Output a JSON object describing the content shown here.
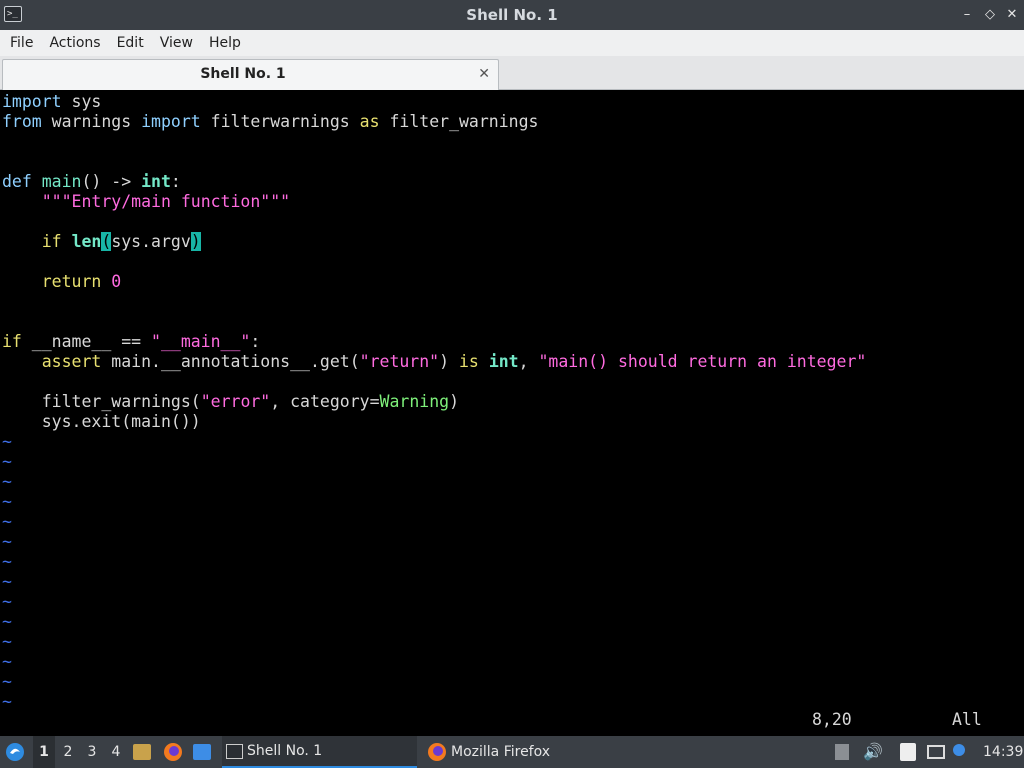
{
  "window": {
    "title": "Shell No. 1",
    "controls": {
      "minimize": "–",
      "restore": "◇",
      "close": "✕"
    }
  },
  "menu": [
    "File",
    "Actions",
    "Edit",
    "View",
    "Help"
  ],
  "tab": {
    "label": "Shell No. 1",
    "close": "✕"
  },
  "editor": {
    "lines": {
      "l1": {
        "import": "import",
        "mod": " sys"
      },
      "l2": {
        "from": "from",
        "mod": " warnings ",
        "import": "import",
        "name": " filterwarnings ",
        "as": "as",
        "alias": " filter_warnings"
      },
      "l3": {
        "def": "def",
        "sp": " ",
        "name": "main",
        "sig": "() -> ",
        "type": "int",
        "colon": ":"
      },
      "l4": {
        "indent": "    ",
        "doc": "\"\"\"Entry/main function\"\"\""
      },
      "l5": {
        "indent": "    ",
        "if": "if",
        "sp": " ",
        "len": "len",
        "open": "(",
        "arg": "sys.argv",
        "close": ")"
      },
      "l6": {
        "indent": "    ",
        "return": "return",
        "sp": " ",
        "val": "0"
      },
      "l7": {
        "if": "if",
        "cond": " __name__ == ",
        "str": "\"__main__\"",
        "colon": ":"
      },
      "l8": {
        "indent": "    ",
        "assert": "assert",
        "expr1": " main.__annotations__.get(",
        "s1": "\"return\"",
        "expr2": ") ",
        "is": "is",
        "sp": " ",
        "int": "int",
        "comma": ", ",
        "s2": "\"main() should return an integer\""
      },
      "l9": {
        "indent": "    ",
        "call": "filter_warnings(",
        "s1": "\"error\"",
        "mid": ", category=",
        "cls": "Warning",
        "close": ")"
      },
      "l10": {
        "indent": "    ",
        "code": "sys.exit(main())"
      }
    },
    "tilde": "~",
    "position": "8,20",
    "scroll": "All"
  },
  "taskbar": {
    "workspaces": [
      "1",
      "2",
      "3",
      "4"
    ],
    "tasks": [
      "Shell No. 1",
      "Mozilla Firefox"
    ],
    "clock": "14:39"
  },
  "colors": {
    "keyword": "#8fd0ff",
    "string": "#ff6be0",
    "function": "#74e8c8",
    "tilde": "#3f6fe8",
    "accent": "#2e8be0"
  }
}
